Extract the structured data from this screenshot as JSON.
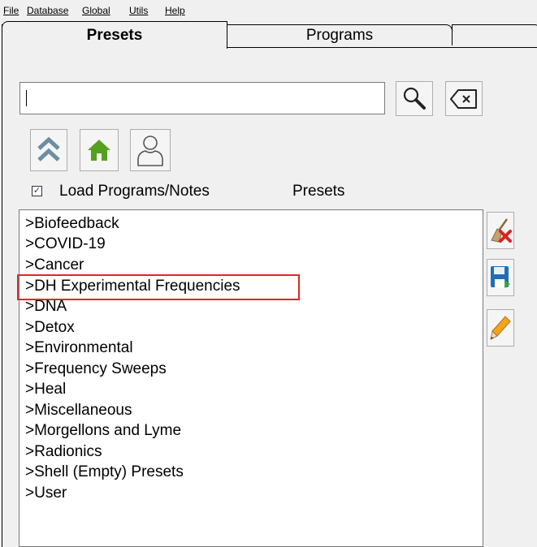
{
  "menu": {
    "file": "File",
    "database": "Database",
    "global": "Global",
    "utils": "Utils",
    "help": "Help"
  },
  "tabs": [
    {
      "label": "Presets",
      "active": true
    },
    {
      "label": "Programs",
      "active": false
    },
    {
      "label": "",
      "active": false
    }
  ],
  "search": {
    "value": "",
    "search_icon": "magnifier-icon",
    "clear_icon": "backspace-clear-icon"
  },
  "nav_buttons": [
    {
      "icon": "double-chevron-up-icon"
    },
    {
      "icon": "home-icon"
    },
    {
      "icon": "user-icon"
    }
  ],
  "options": {
    "load_programs_checked": true,
    "load_programs_label": "Load Programs/Notes",
    "list_title": "Presets"
  },
  "presets": [
    ">Biofeedback",
    ">COVID-19",
    ">Cancer",
    ">DH Experimental Frequencies",
    ">DNA",
    ">Detox",
    ">Environmental",
    ">Frequency Sweeps",
    ">Heal",
    ">Miscellaneous",
    ">Morgellons and Lyme",
    ">Radionics",
    ">Shell (Empty) Presets",
    ">User"
  ],
  "highlighted_preset": ">DH Experimental Frequencies",
  "side_buttons": [
    {
      "icon": "broom-delete-icon"
    },
    {
      "icon": "save-disk-icon"
    },
    {
      "icon": "pencil-edit-icon"
    }
  ],
  "colors": {
    "highlight_border": "#e0262b",
    "home_green": "#56a020",
    "save_blue": "#1f6fb5"
  }
}
